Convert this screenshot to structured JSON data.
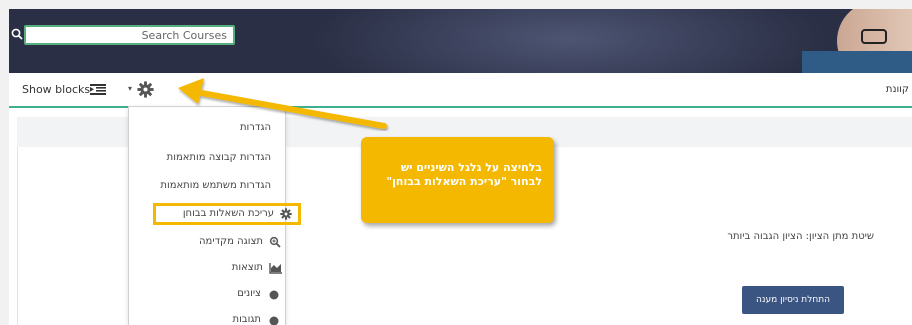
{
  "search": {
    "placeholder": "Search Courses"
  },
  "toolbar": {
    "show_blocks_label": "Show blocks",
    "right_text": "קוונת"
  },
  "menu": {
    "items": [
      {
        "label": "הגדרות",
        "icon": ""
      },
      {
        "label": "הגדרות קבוצה מותאמות",
        "icon": ""
      },
      {
        "label": "הגדרות משתמש מותאמות",
        "icon": ""
      },
      {
        "label": "עריכת השאלות בבוחן",
        "icon": "gear-icon"
      },
      {
        "label": "תצוגה מקדימה",
        "icon": "magnifier-icon"
      },
      {
        "label": "תוצאות",
        "icon": "chart-icon"
      },
      {
        "label": "ציונים",
        "icon": "dot-icon"
      },
      {
        "label": "תגובות",
        "icon": "dot-icon"
      }
    ]
  },
  "content": {
    "grading_method": "שיטת מתן הציון: הציון הגבוה ביותר",
    "start_attempt_label": "התחלת ניסיון מענה"
  },
  "callout": {
    "text": "בלחיצה על גלגל השיניים יש לבחור \"עריכת השאלות בבוחן\""
  },
  "colors": {
    "accent": "#3eb08f",
    "callout": "#f5b800",
    "button": "#3b5583"
  }
}
